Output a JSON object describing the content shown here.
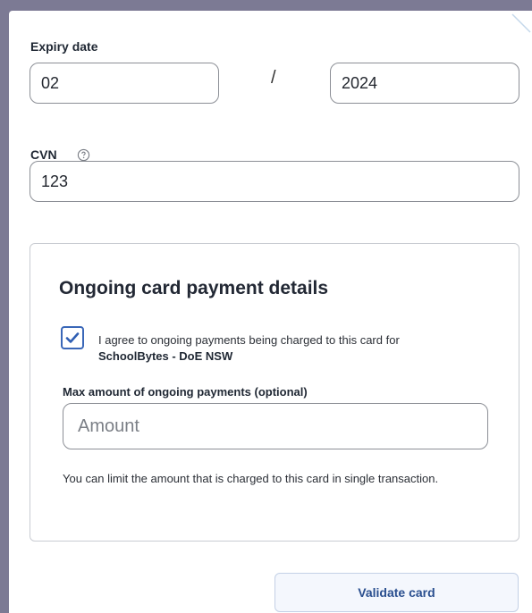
{
  "expiry": {
    "label": "Expiry date",
    "month_value": "02",
    "separator": "/",
    "year_value": "2024"
  },
  "cvn": {
    "label": "CVN",
    "value": "123",
    "help_icon": "question-circle-icon"
  },
  "ongoing": {
    "title": "Ongoing card payment details",
    "agree_checked": true,
    "agree_text": "I agree to ongoing payments being charged to this card for",
    "agree_merchant": "SchoolBytes - DoE NSW",
    "max_label": "Max amount of ongoing payments (optional)",
    "amount_placeholder": "Amount",
    "hint": "You can limit the amount that is charged to this card in single transaction."
  },
  "actions": {
    "validate_label": "Validate card"
  },
  "colors": {
    "background": "#7c7a94",
    "accent": "#3a67b8",
    "button_text": "#2a4f8f"
  }
}
